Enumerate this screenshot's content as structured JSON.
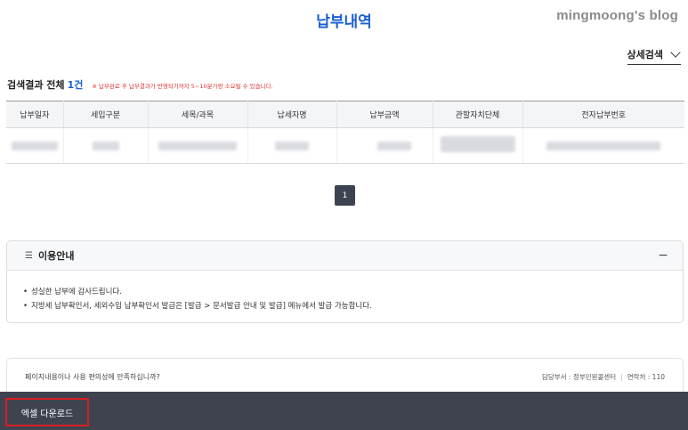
{
  "header": {
    "title": "납부내역",
    "watermark": "mingmoong's blog"
  },
  "search": {
    "detail_label": "상세검색"
  },
  "results": {
    "label": "검색결과 전체",
    "count": "1건",
    "notice": "※ 납부완료 후 납부결과가 반영되기까지 5~10분가량 소요될 수 있습니다."
  },
  "table": {
    "columns": [
      "납부일자",
      "세입구분",
      "세목/과목",
      "납세자명",
      "납부금액",
      "관할자치단체",
      "전자납부번호"
    ],
    "rows": [
      {
        "cells": [
          "",
          "",
          "",
          "",
          "",
          "",
          ""
        ],
        "redacted": true
      }
    ]
  },
  "pagination": {
    "current_page": "1"
  },
  "guide": {
    "icon": "list-search-icon",
    "title": "이용안내",
    "toggle": "−",
    "items": [
      "성실한 납부에 감사드립니다.",
      "지방세 납부확인서, 세외수입 납부확인서 발급은 [발급 > 문서발급 안내 및 발급] 메뉴에서 발급 가능합니다."
    ]
  },
  "survey": {
    "question": "페이지내용이나 사용 편의성에 만족하십니까?",
    "department": "담당부서 : 정부민원콜센터",
    "contact": "연락처 : 110"
  },
  "bottom_bar": {
    "excel_button": "엑셀 다운로드",
    "highlight_color": "#d62020"
  },
  "colors": {
    "accent": "#1a5fd0",
    "notice": "#dd3333",
    "dark_bar": "#3e434f"
  }
}
